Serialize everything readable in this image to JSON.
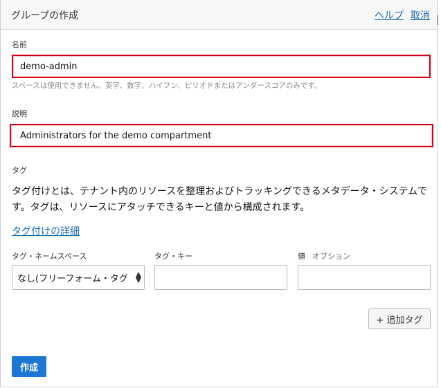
{
  "header": {
    "title": "グループの作成",
    "help_link": "ヘルプ",
    "cancel_link": "取消"
  },
  "form": {
    "name": {
      "label": "名前",
      "value": "demo-admin",
      "hint": "スペースは使用できません。英字、数字、ハイフン、ピリオドまたはアンダースコアのみです。"
    },
    "description": {
      "label": "説明",
      "value": "Administrators for the demo compartment"
    }
  },
  "tags": {
    "heading": "タグ",
    "description": "タグ付けとは、テナント内のリソースを整理およびトラッキングできるメタデータ・システムです。タグは、リソースにアタッチできるキーと値から構成されます。",
    "details_link": "タグ付けの詳細",
    "namespace_label": "タグ・ネームスペース",
    "namespace_value": "なし(フリーフォーム・タグ",
    "key_label": "タグ・キー",
    "value_label": "値",
    "value_optional": "オプション",
    "add_tag_button": "+ 追加タグ"
  },
  "footer": {
    "create_button": "作成"
  },
  "colors": {
    "accent": "#1c78d4",
    "link": "#1c6bb5",
    "highlight_border": "#d0021b"
  }
}
